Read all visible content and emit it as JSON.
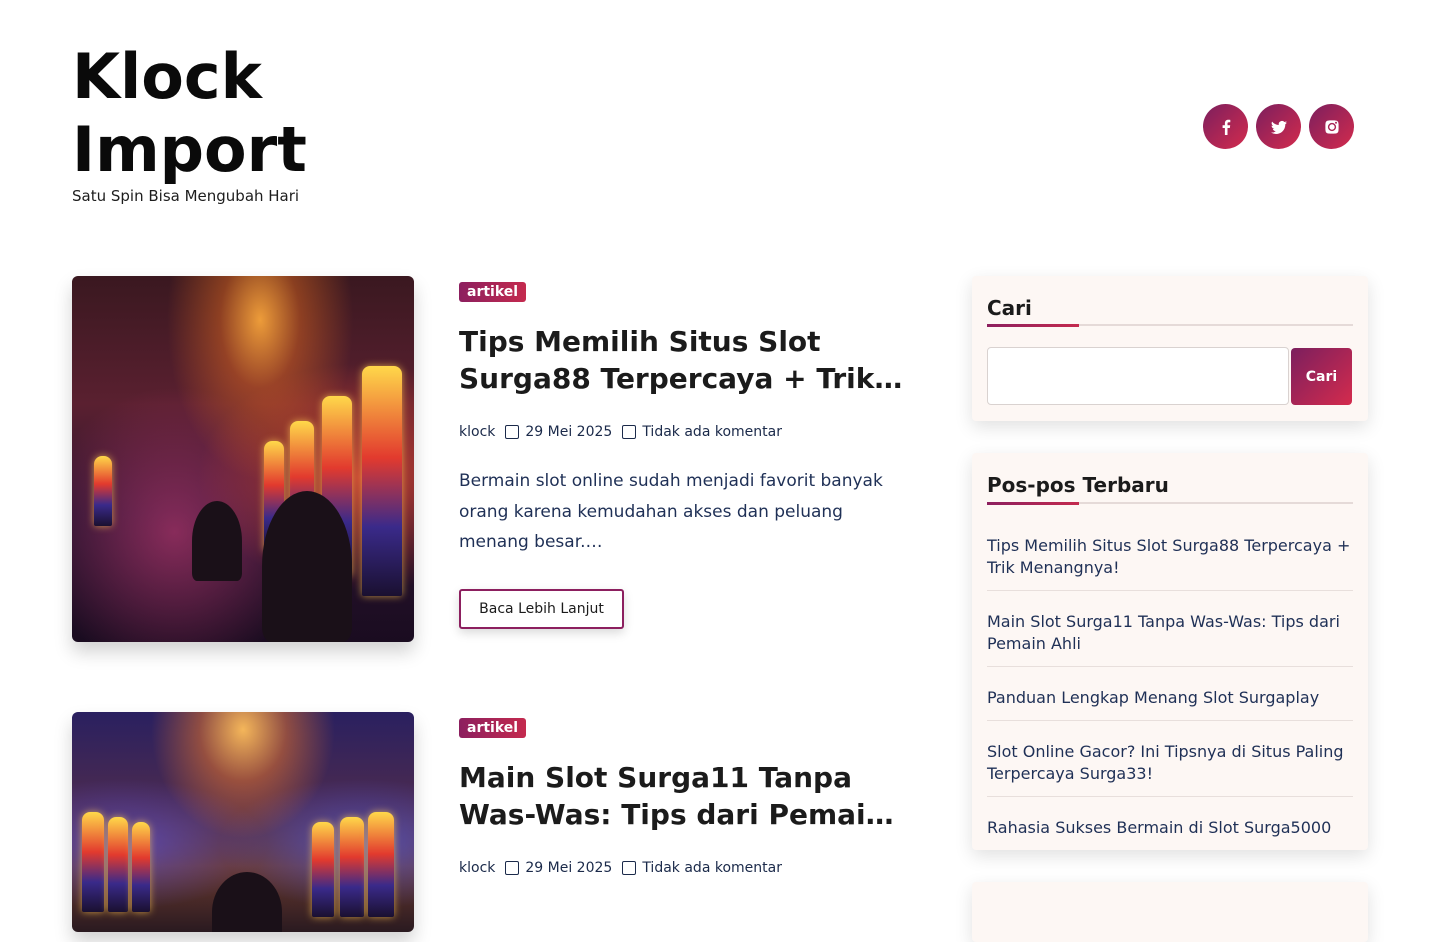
{
  "site": {
    "title": "Klock Import",
    "tagline": "Satu Spin Bisa Mengubah Hari"
  },
  "social": [
    {
      "icon": "facebook-icon"
    },
    {
      "icon": "twitter-icon"
    },
    {
      "icon": "instagram-icon"
    }
  ],
  "posts": [
    {
      "category": "artikel",
      "title": "Tips Memilih Situs Slot Surga88 Terpercaya + Trik…",
      "author": "klock",
      "date": "29 Mei 2025",
      "comments": "Tidak ada komentar",
      "excerpt": "Bermain slot online sudah menjadi favorit banyak orang karena kemudahan akses dan peluang menang besar.…",
      "read_more": "Baca Lebih Lanjut"
    },
    {
      "category": "artikel",
      "title": "Main Slot Surga11 Tanpa Was-Was: Tips dari Pemai…",
      "author": "klock",
      "date": "29 Mei 2025",
      "comments": "Tidak ada komentar"
    }
  ],
  "search_widget": {
    "title": "Cari",
    "value": "",
    "button": "Cari"
  },
  "recent_widget": {
    "title": "Pos-pos Terbaru",
    "items": [
      "Tips Memilih Situs Slot Surga88 Terpercaya + Trik Menangnya!",
      "Main Slot Surga11 Tanpa Was-Was: Tips dari Pemain Ahli",
      "Panduan Lengkap Menang Slot Surgaplay",
      "Slot Online Gacor? Ini Tipsnya di Situs Paling Terpercaya Surga33!",
      "Rahasia Sukses Bermain di Slot Surga5000"
    ]
  },
  "colors": {
    "accent_start": "#7b1f5e",
    "accent_end": "#d42b4d",
    "text_link": "#1f3056",
    "widget_bg": "#fdf7f4"
  }
}
